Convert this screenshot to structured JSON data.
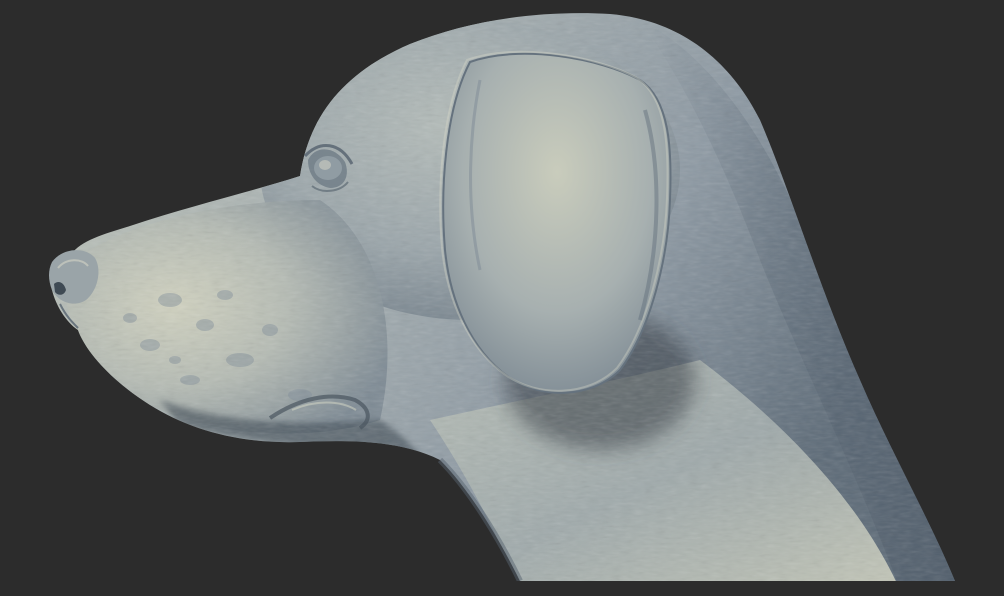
{
  "scene": {
    "subject": "dog-head-sculpt",
    "view": "left-profile",
    "colors": {
      "background": "#2c2c2c",
      "clay_light": "#c8ccbc",
      "clay_mid": "#8e9aa2",
      "clay_dark": "#4d5a66",
      "shadow": "#2f363d"
    }
  }
}
